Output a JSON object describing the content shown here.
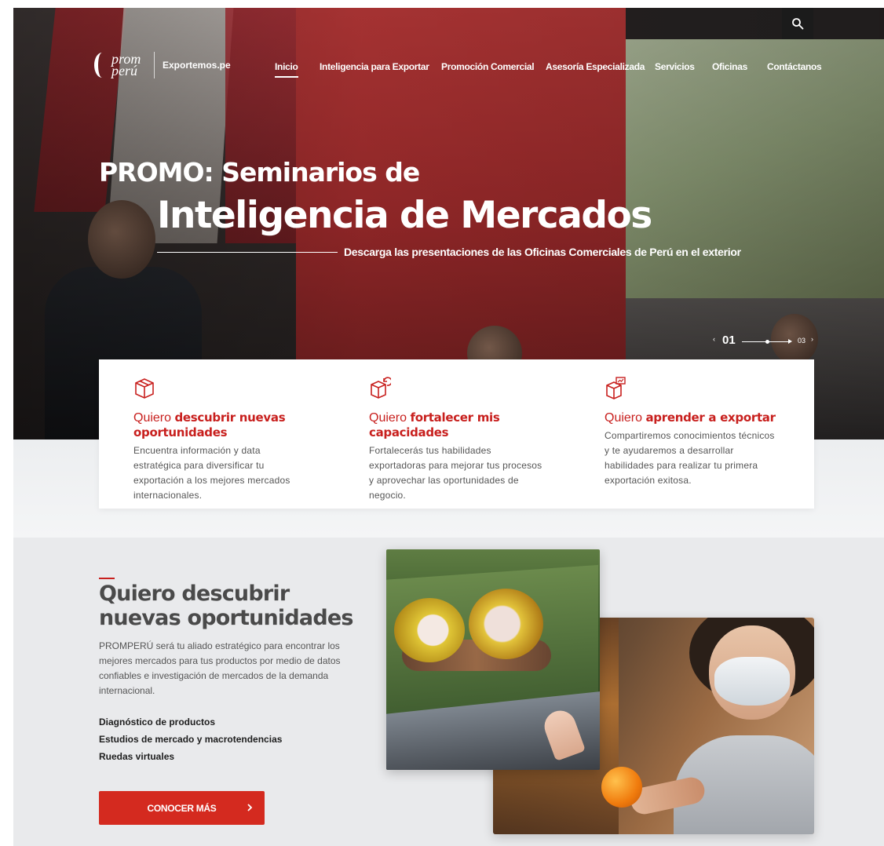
{
  "header": {
    "logo_text": "prom perú",
    "site_name": "Exportemos.pe",
    "nav": [
      {
        "label": "Inicio",
        "active": true
      },
      {
        "label": "Inteligencia para Exportar",
        "active": false
      },
      {
        "label": "Promoción Comercial",
        "active": false
      },
      {
        "label": "Asesoría Especializada",
        "active": false
      },
      {
        "label": "Servicios",
        "active": false
      },
      {
        "label": "Oficinas",
        "active": false
      },
      {
        "label": "Contáctanos",
        "active": false
      }
    ],
    "search_icon": "search-icon"
  },
  "hero": {
    "title_line1": "PROMO: Seminarios de",
    "title_line2": "Inteligencia de Mercados",
    "subtitle": "Descarga las presentaciones de las Oficinas Comerciales de Perú en el exterior",
    "pager": {
      "prev": "‹",
      "current": "01",
      "total": "03",
      "next": "›"
    }
  },
  "cards": [
    {
      "icon": "box-icon",
      "lead": "Quiero ",
      "bold": "descubrir nuevas oportunidades",
      "text": "Encuentra información y data estratégica para diversificar tu exportación a los mejores mercados internacionales."
    },
    {
      "icon": "box-refresh-icon",
      "lead": "Quiero ",
      "bold": "fortalecer mis capacidades",
      "text": "Fortalecerás tus habilidades exportadoras para mejorar tus procesos y aprovechar las oportunidades de negocio."
    },
    {
      "icon": "box-presentation-icon",
      "lead": "Quiero ",
      "bold": "aprender a exportar",
      "text": "Compartiremos conocimientos técnicos y te ayudaremos a desarrollar habilidades para realizar tu primera exportación exitosa."
    }
  ],
  "feature": {
    "title": "Quiero descubrir nuevas oportunidades",
    "text": "PROMPERÚ será tu aliado estratégico para encontrar los mejores mercados para tus productos por medio de datos confiables e investigación de mercados de la demanda internacional.",
    "list": [
      "Diagnóstico de productos",
      "Estudios de mercado y macrotendencias",
      "Ruedas virtuales"
    ],
    "button_label": "CONOCER MÁS"
  },
  "colors": {
    "brand_red": "#c8201e",
    "button_red": "#d42a1f",
    "band_gray": "#e9eaec"
  }
}
